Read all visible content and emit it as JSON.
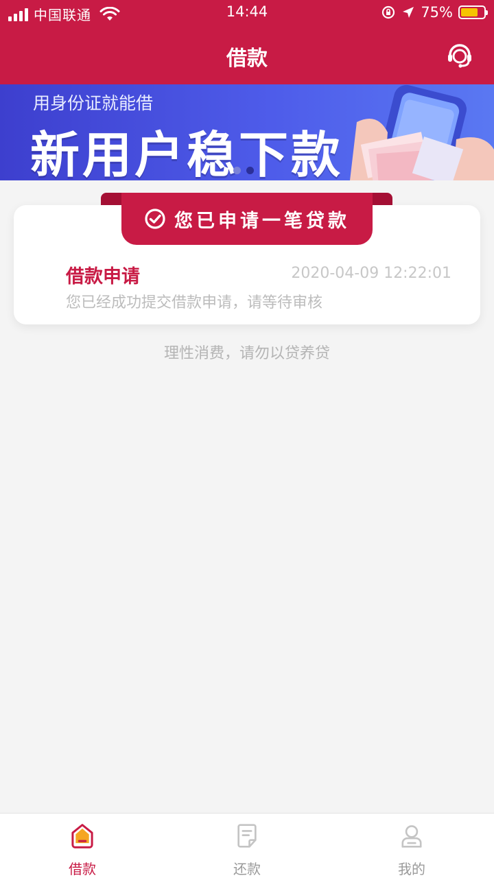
{
  "status_bar": {
    "carrier": "中国联通",
    "time": "14:44",
    "battery": "75%",
    "battery_level": 0.75
  },
  "nav": {
    "title": "借款",
    "support_icon": "headset-icon"
  },
  "banner": {
    "subtitle": "用身份证就能借",
    "title": "新用户稳下款",
    "pages": 2,
    "active_page": 2
  },
  "card": {
    "ribbon_label": "您已申请一笔贷款",
    "title": "借款申请",
    "timestamp": "2020-04-09 12:22:01",
    "description": "您已经成功提交借款申请，请等待审核"
  },
  "notice": "理性消费，请勿以贷养贷",
  "tabs": [
    {
      "label": "借款",
      "icon": "home-icon",
      "active": true
    },
    {
      "label": "还款",
      "icon": "document-icon",
      "active": false
    },
    {
      "label": "我的",
      "icon": "profile-icon",
      "active": false
    }
  ],
  "colors": {
    "primary": "#c81b45",
    "banner_start": "#3d3fce",
    "banner_end": "#5a78f2",
    "background": "#f4f4f4",
    "battery": "#f6c400"
  }
}
